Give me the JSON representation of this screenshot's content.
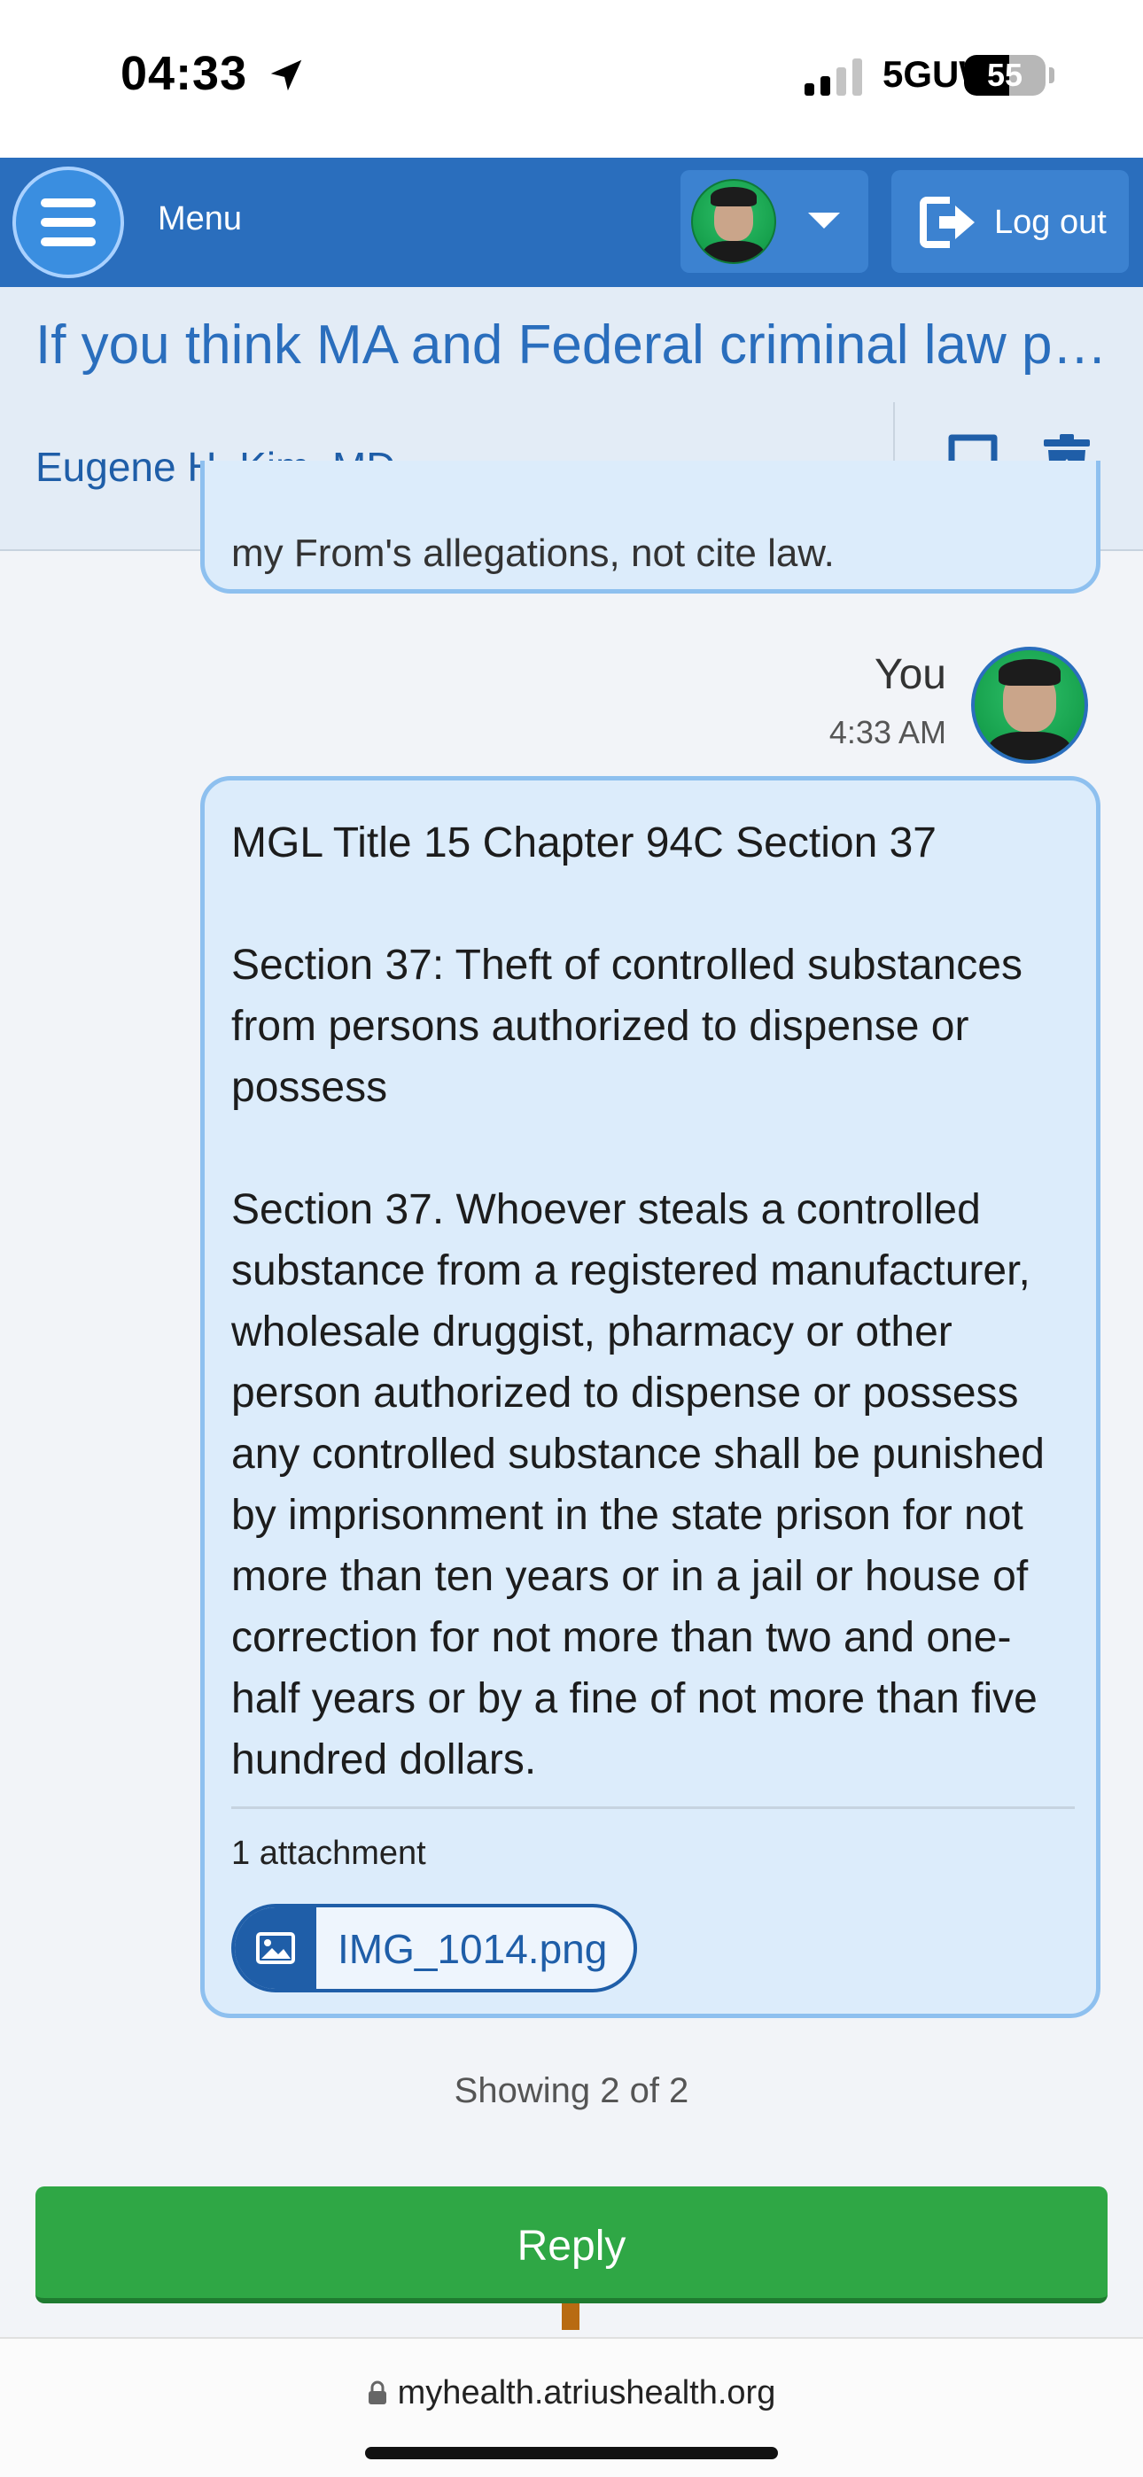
{
  "status_bar": {
    "time": "04:33",
    "location_icon": "location-arrow-icon",
    "network": "5GUW",
    "battery_percent": 55,
    "battery_label": "55"
  },
  "header": {
    "menu_label": "Menu",
    "logout_label": "Log out",
    "user_avatar_icon": "user-avatar",
    "dropdown_icon": "chevron-down-icon"
  },
  "message": {
    "subject": "If you think MA and Federal criminal law pr…",
    "provider": "Eugene H. Kim, MD",
    "bookmark_icon": "bookmark-icon",
    "trash_icon": "trash-icon"
  },
  "previous_message": {
    "partial_text": "my From's allegations, not cite law."
  },
  "latest_message": {
    "sender": "You",
    "time": "4:33 AM",
    "paragraphs": [
      "MGL Title 15 Chapter 94C Section 37",
      "Section 37: Theft of controlled substances from persons authorized to dispense or possess",
      "Section 37. Whoever steals a controlled substance from a registered manufacturer, wholesale druggist, pharmacy or other person authorized to dispense or possess any controlled substance shall be punished by imprisonment in the state prison for not more than ten years or in a jail or house of correction for not more than two and one-half years or by a fine of not more than five hundred dollars."
    ],
    "attachment_count_label": "1 attachment",
    "attachment_name": "IMG_1014.png",
    "attachment_icon": "image-icon"
  },
  "pagination": {
    "label": "Showing 2 of 2"
  },
  "reply_button": {
    "label": "Reply"
  },
  "browser": {
    "url": "myhealth.atriushealth.org",
    "lock_icon": "lock-icon"
  },
  "colors": {
    "header_blue": "#2a6ebd",
    "bubble_fill": "#dcecfb",
    "bubble_border": "#8ec0ef",
    "reply_green": "#2fa745",
    "link_blue": "#1f5ea8"
  }
}
